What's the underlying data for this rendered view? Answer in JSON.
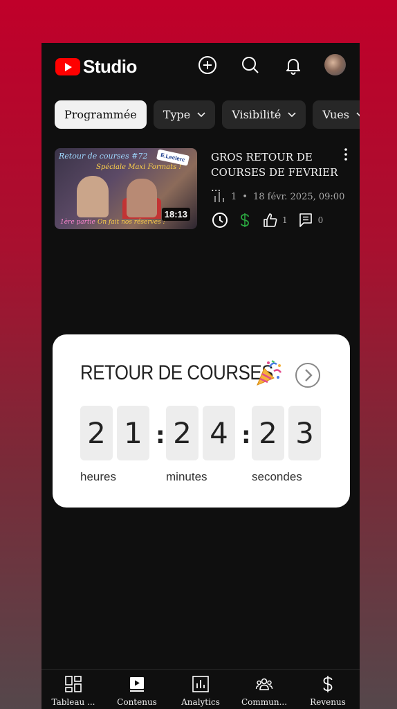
{
  "app": {
    "name": "Studio"
  },
  "filters": [
    {
      "label": "Programmée",
      "active": true,
      "dropdown": false
    },
    {
      "label": "Type",
      "active": false,
      "dropdown": true
    },
    {
      "label": "Visibilité",
      "active": false,
      "dropdown": true
    },
    {
      "label": "Vues",
      "active": false,
      "dropdown": true
    }
  ],
  "video": {
    "title_line1": "GROS RETOUR DE",
    "title_line2": "COURSES DE FEVRIER ...",
    "views": "1",
    "scheduled": "18 févr. 2025, 09:00",
    "separator": "•",
    "duration": "18:13",
    "likes": "1",
    "comments": "0",
    "thumbnail": {
      "title": "Retour de courses #72",
      "subtitle": "Spéciale Maxi Formats !",
      "badge": "E.Leclerc",
      "part": "1ère partie",
      "tagline": "On fait nos réserves !"
    }
  },
  "countdown": {
    "title": "RETOUR DE COURSES",
    "digits": {
      "h1": "2",
      "h2": "1",
      "m1": "2",
      "m2": "4",
      "s1": "2",
      "s2": "3"
    },
    "separator": ":",
    "units": {
      "hours": "heures",
      "minutes": "minutes",
      "seconds": "secondes"
    }
  },
  "bottom_nav": [
    {
      "label": "Tableau ...",
      "icon": "dashboard-icon"
    },
    {
      "label": "Contenus",
      "icon": "content-icon"
    },
    {
      "label": "Analytics",
      "icon": "analytics-icon"
    },
    {
      "label": "Commun...",
      "icon": "community-icon"
    },
    {
      "label": "Revenus",
      "icon": "revenue-icon"
    }
  ],
  "colors": {
    "brand": "#ff0000",
    "monetization": "#2ba640",
    "background": "#0f0f0f",
    "chip": "#272727"
  }
}
